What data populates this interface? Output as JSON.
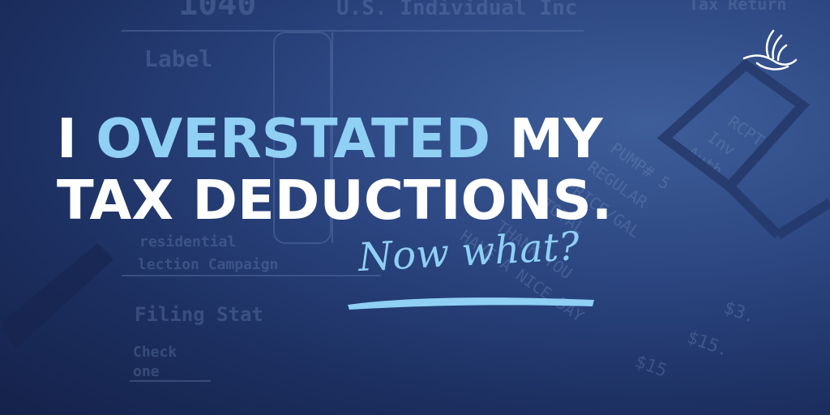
{
  "headline": {
    "line1_prefix": "I ",
    "line1_accent": "OVERSTATED",
    "line1_suffix": " MY",
    "line2": "TAX DEDUCTIONS."
  },
  "subhead": "Now what?",
  "background_form": {
    "form_number": "1040",
    "form_title": "U.S. Individual Inc",
    "return_label": "Tax Return",
    "label": "Label",
    "presidential": "residential",
    "election": "lection Campaign",
    "filing_status": "Filing Stat",
    "check": "Check",
    "one": "one",
    "receipt_lines": [
      "RCPT",
      "Inv",
      "Auth",
      "PUMP# 5",
      "REGULAR",
      "PRICE/GAL",
      "TOTAL",
      "THANK YOU",
      "HAVE A NICE DAY",
      "$3.",
      "$15.",
      "$15"
    ]
  },
  "colors": {
    "accent": "#8fd0f4",
    "headline": "#ffffff",
    "background": "#1c2f60"
  },
  "icons": {
    "logo": "bird-logo-icon"
  }
}
